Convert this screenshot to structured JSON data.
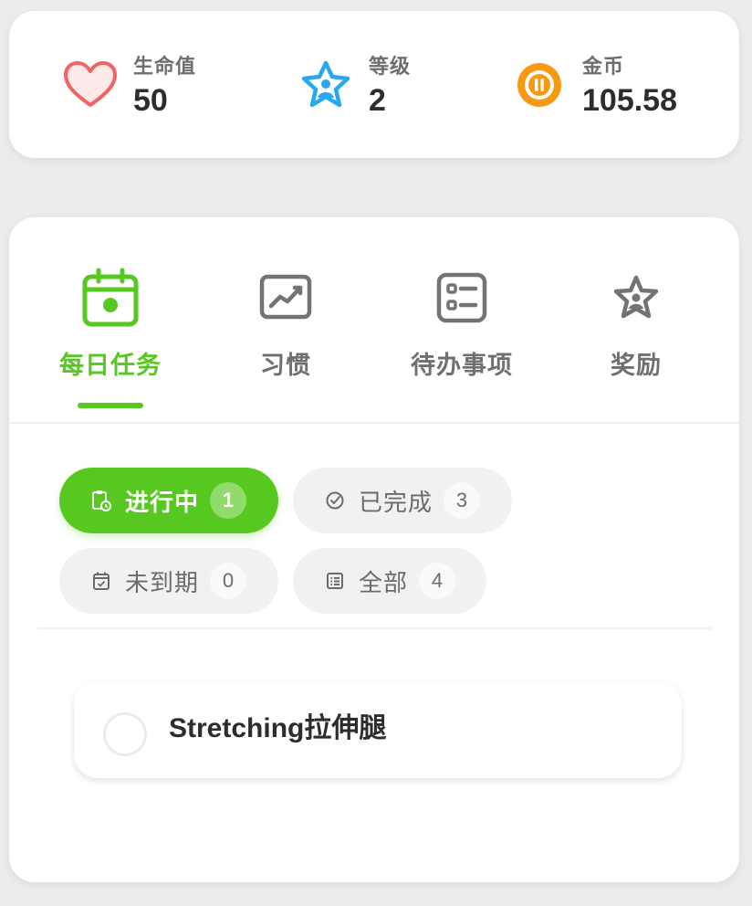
{
  "stats": {
    "hp": {
      "label": "生命值",
      "value": "50",
      "icon": "heart-icon",
      "color": "#f26363"
    },
    "level": {
      "label": "等级",
      "value": "2",
      "icon": "star-icon",
      "color": "#29a8f0"
    },
    "gold": {
      "label": "金币",
      "value": "105.58",
      "icon": "coin-icon",
      "color": "#f79a12"
    }
  },
  "tabs": [
    {
      "label": "每日任务",
      "icon": "calendar-icon",
      "active": true
    },
    {
      "label": "习惯",
      "icon": "chart-icon",
      "active": false
    },
    {
      "label": "待办事项",
      "icon": "list-icon",
      "active": false
    },
    {
      "label": "奖励",
      "icon": "star-outline-icon",
      "active": false
    }
  ],
  "filters": [
    {
      "label": "进行中",
      "count": "1",
      "icon": "clipboard-clock-icon",
      "active": true
    },
    {
      "label": "已完成",
      "count": "3",
      "icon": "check-circle-icon",
      "active": false
    },
    {
      "label": "未到期",
      "count": "0",
      "icon": "calendar-check-icon",
      "active": false
    },
    {
      "label": "全部",
      "count": "4",
      "icon": "list-small-icon",
      "active": false
    }
  ],
  "tasks": [
    {
      "title": "Stretching拉伸腿",
      "completed": false
    }
  ],
  "colors": {
    "accent": "#57c81f",
    "inactive": "#6f6f6f",
    "background": "#ebecee"
  }
}
